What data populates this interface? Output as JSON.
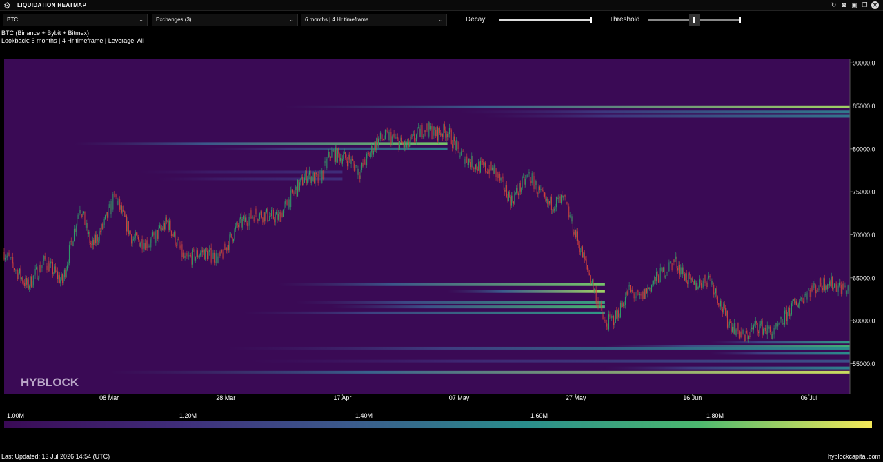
{
  "app": {
    "title": "LIQUIDATION HEATMAP"
  },
  "icons": [
    "gear-icon",
    "refresh-icon",
    "camera-icon",
    "save-icon",
    "copy-icon",
    "close-icon"
  ],
  "toolbar": {
    "symbol": "BTC",
    "exchanges": "Exchanges  (3)",
    "timeframe": "6 months | 4 Hr timeframe",
    "decay_label": "Decay",
    "threshold_label": "Threshold"
  },
  "info": {
    "line1": "BTC (Binance + Bybit + Bitmex)",
    "line2": "Lookback: 6 months | 4 Hr timeframe | Leverage: All"
  },
  "watermark": "HYBLOCK",
  "colorbar": {
    "labels": [
      "1.00M",
      "1.20M",
      "1.40M",
      "1.60M",
      "1.80M"
    ],
    "colors": [
      "#3a0a55",
      "#3f2d7a",
      "#3b5b8c",
      "#2a8e8c",
      "#4cb86f",
      "#f4e959"
    ]
  },
  "footer": {
    "updated": "Last Updated: 13 Jul 2026 14:54 (UTC)",
    "site": "hyblockcapital.com"
  },
  "chart_data": {
    "type": "heatmap",
    "background_color": "#3a0a55",
    "x_ticks": [
      "08 Mar",
      "28 Mar",
      "17 Apr",
      "07 May",
      "27 May",
      "16 Jun",
      "06 Jul"
    ],
    "y_ticks": [
      "90000.0",
      "85000.0",
      "80000.0",
      "75000.0",
      "70000.0",
      "65000.0",
      "60000.0",
      "55000.0"
    ],
    "ylim": [
      51500,
      90500
    ],
    "x_range": [
      "2026-02-18",
      "2026-07-13"
    ],
    "price_path": {
      "dates": [
        "2026-02-18",
        "2026-02-22",
        "2026-02-25",
        "2026-02-28",
        "2026-03-03",
        "2026-03-05",
        "2026-03-07",
        "2026-03-09",
        "2026-03-12",
        "2026-03-15",
        "2026-03-18",
        "2026-03-21",
        "2026-03-24",
        "2026-03-27",
        "2026-03-30",
        "2026-04-02",
        "2026-04-06",
        "2026-04-09",
        "2026-04-11",
        "2026-04-13",
        "2026-04-15",
        "2026-04-18",
        "2026-04-20",
        "2026-04-23",
        "2026-04-25",
        "2026-04-28",
        "2026-05-01",
        "2026-05-03",
        "2026-05-05",
        "2026-05-07",
        "2026-05-10",
        "2026-05-13",
        "2026-05-16",
        "2026-05-19",
        "2026-05-22",
        "2026-05-25",
        "2026-05-28",
        "2026-05-30",
        "2026-06-01",
        "2026-06-03",
        "2026-06-05",
        "2026-06-07",
        "2026-06-10",
        "2026-06-13",
        "2026-06-16",
        "2026-06-19",
        "2026-06-22",
        "2026-06-25",
        "2026-06-27",
        "2026-06-30",
        "2026-07-03",
        "2026-07-06",
        "2026-07-09",
        "2026-07-13"
      ],
      "values": [
        68000,
        64000,
        67000,
        64500,
        73500,
        68500,
        71000,
        74500,
        69500,
        69000,
        71500,
        67000,
        68000,
        67200,
        71000,
        72500,
        72000,
        75200,
        77000,
        76200,
        79500,
        78800,
        77300,
        81000,
        81500,
        80200,
        82500,
        81800,
        82100,
        79500,
        78000,
        77500,
        74000,
        77000,
        73500,
        74000,
        68000,
        64000,
        59500,
        60500,
        63500,
        62500,
        65000,
        67000,
        64000,
        65000,
        60000,
        58000,
        59500,
        58500,
        61500,
        63500,
        64500,
        63500
      ]
    },
    "bands": [
      {
        "price": 84900,
        "start": "2026-04-07",
        "peak": 1.9
      },
      {
        "price": 84300,
        "start": "2026-05-07",
        "peak": 1.52
      },
      {
        "price": 83800,
        "start": "2026-05-11",
        "peak": 1.5
      },
      {
        "price": 80600,
        "start": "2026-03-02",
        "end": "2026-05-05",
        "peak": 1.85
      },
      {
        "price": 80000,
        "start": "2026-03-24",
        "end": "2026-05-05",
        "peak": 1.55
      },
      {
        "price": 77300,
        "start": "2026-03-13",
        "end": "2026-04-17",
        "peak": 1.2
      },
      {
        "price": 76500,
        "start": "2026-03-16",
        "end": "2026-04-17",
        "peak": 1.2
      },
      {
        "price": 64200,
        "start": "2026-04-06",
        "end": "2026-06-01",
        "peak": 1.85
      },
      {
        "price": 63400,
        "start": "2026-05-05",
        "end": "2026-06-01",
        "peak": 1.9
      },
      {
        "price": 62100,
        "start": "2026-04-09",
        "end": "2026-06-01",
        "peak": 1.7
      },
      {
        "price": 61600,
        "start": "2026-04-15",
        "end": "2026-06-01",
        "peak": 1.78
      },
      {
        "price": 60900,
        "start": "2026-03-31",
        "end": "2026-06-01",
        "peak": 1.65
      },
      {
        "price": 57500,
        "start": "2026-06-19",
        "peak": 1.65
      },
      {
        "price": 57000,
        "start": "2026-06-01",
        "peak": 1.75
      },
      {
        "price": 56800,
        "start": "2026-03-28",
        "peak": 1.6
      },
      {
        "price": 56200,
        "start": "2026-06-19",
        "peak": 1.6
      },
      {
        "price": 55300,
        "start": "2026-04-01",
        "peak": 1.35
      },
      {
        "price": 54500,
        "start": "2026-06-01",
        "peak": 1.55
      },
      {
        "price": 54000,
        "start": "2026-03-08",
        "peak": 1.95
      }
    ]
  }
}
